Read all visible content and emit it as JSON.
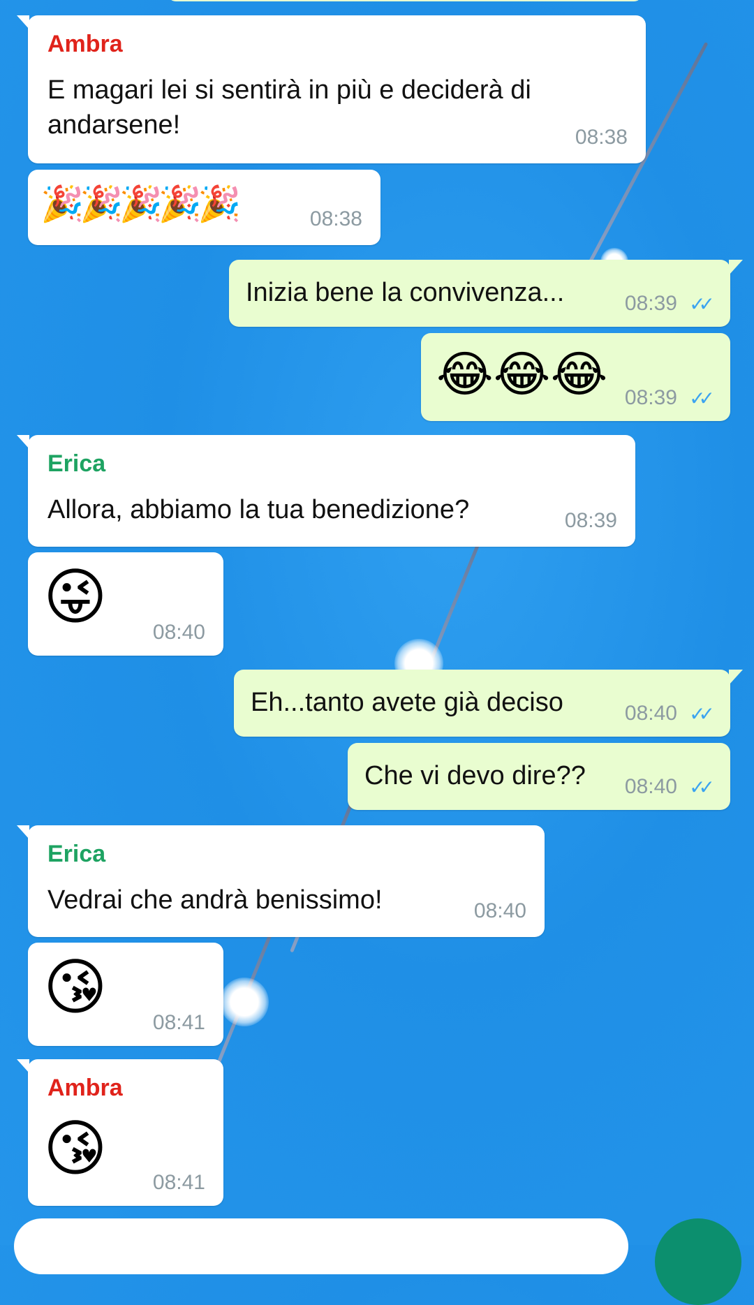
{
  "messages": [
    {
      "sender": "Ambra",
      "text_line1": "E magari lei si sentirà in più e deciderà di",
      "text_line2": "andarsene!",
      "time": "08:38"
    },
    {
      "emoji": "🎉🎉🎉🎉🎉",
      "time": "08:38"
    },
    {
      "text": "Inizia bene la convivenza...",
      "time": "08:39"
    },
    {
      "emoji": "😂😂😂",
      "time": "08:39"
    },
    {
      "sender": "Erica",
      "text": "Allora, abbiamo la tua benedizione?",
      "time": "08:39"
    },
    {
      "emoji": "😜",
      "time": "08:40"
    },
    {
      "text": "Eh...tanto avete già deciso",
      "time": "08:40"
    },
    {
      "text": "Che vi devo dire??",
      "time": "08:40"
    },
    {
      "sender": "Erica",
      "text": "Vedrai che andrà benissimo!",
      "time": "08:40"
    },
    {
      "emoji": "😘",
      "time": "08:41"
    },
    {
      "sender": "Ambra",
      "emoji": "😘",
      "time": "08:41"
    }
  ],
  "colors": {
    "background": "#1f8fe6",
    "incoming_bubble": "#ffffff",
    "outgoing_bubble": "#e9fdd0",
    "ambra_name": "#e0231b",
    "erica_name": "#1ea362",
    "read_ticks": "#3ba3f0",
    "fab": "#0c8f6e"
  },
  "icons": {
    "read_receipt": "double-check-icon"
  }
}
